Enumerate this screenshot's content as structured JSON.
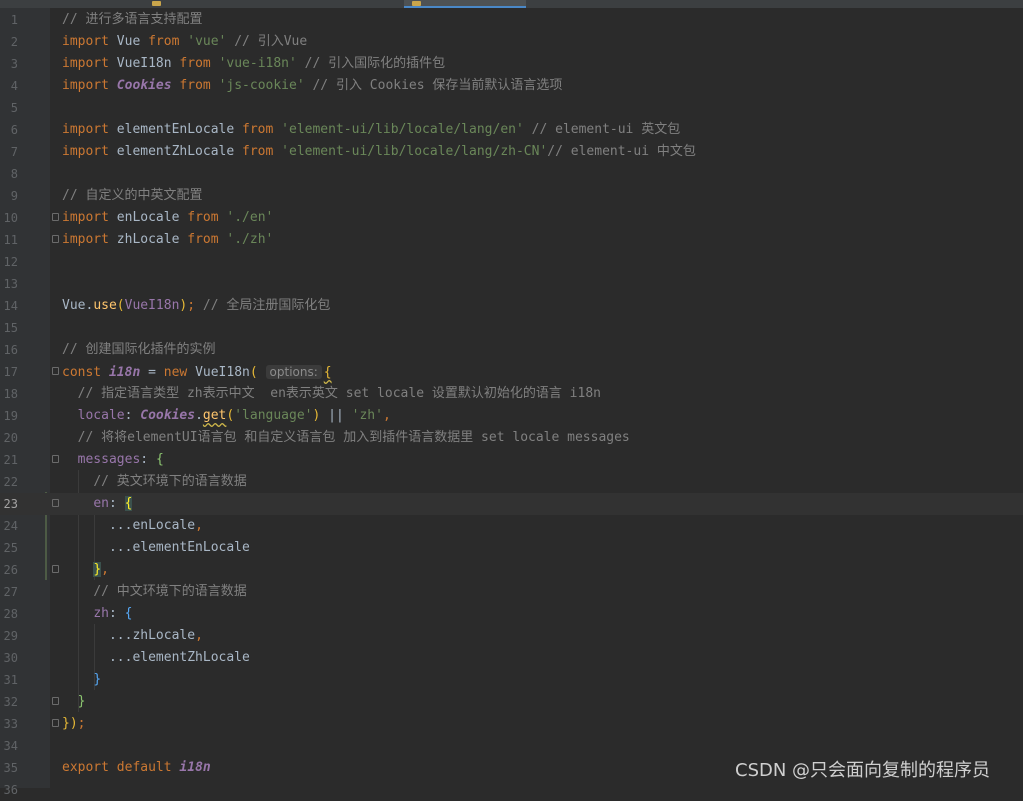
{
  "tabs": [
    {
      "label": ""
    },
    {
      "label": "",
      "active": true
    }
  ],
  "watermark": "CSDN @只会面向复制的程序员",
  "colors": {
    "background": "#2b2b2b",
    "keyword": "#cc7832",
    "string": "#6a8759",
    "comment": "#808080",
    "identifier": "#a9b7c6",
    "instance": "#9876aa",
    "function": "#ffc66d"
  },
  "editor": {
    "current_line": 23,
    "lines": [
      {
        "n": "1",
        "t": "// 进行多语言支持配置"
      },
      {
        "n": "2",
        "t": "import Vue from 'vue' // 引入Vue"
      },
      {
        "n": "3",
        "t": "import VueI18n from 'vue-i18n' // 引入国际化的插件包"
      },
      {
        "n": "4",
        "t": "import Cookies from 'js-cookie' // 引入 Cookies 保存当前默认语言选项"
      },
      {
        "n": "5",
        "t": ""
      },
      {
        "n": "6",
        "t": "import elementEnLocale from 'element-ui/lib/locale/lang/en' // element-ui 英文包"
      },
      {
        "n": "7",
        "t": "import elementZhLocale from 'element-ui/lib/locale/lang/zh-CN'// element-ui 中文包"
      },
      {
        "n": "8",
        "t": ""
      },
      {
        "n": "9",
        "t": "// 自定义的中英文配置"
      },
      {
        "n": "10",
        "t": "import enLocale from './en'"
      },
      {
        "n": "11",
        "t": "import zhLocale from './zh'"
      },
      {
        "n": "12",
        "t": ""
      },
      {
        "n": "13",
        "t": ""
      },
      {
        "n": "14",
        "t": "Vue.use(VueI18n); // 全局注册国际化包"
      },
      {
        "n": "15",
        "t": ""
      },
      {
        "n": "16",
        "t": "// 创建国际化插件的实例"
      },
      {
        "n": "17",
        "t": "const i18n = new VueI18n( options: {"
      },
      {
        "n": "18",
        "t": "  // 指定语言类型 zh表示中文  en表示英文 set locale 设置默认初始化的语言 i18n"
      },
      {
        "n": "19",
        "t": "  locale: Cookies.get('language') || 'zh',"
      },
      {
        "n": "20",
        "t": "  // 将将elementUI语言包 和自定义语言包 加入到插件语言数据里 set locale messages"
      },
      {
        "n": "21",
        "t": "  messages: {"
      },
      {
        "n": "22",
        "t": "    // 英文环境下的语言数据"
      },
      {
        "n": "23",
        "t": "    en: {"
      },
      {
        "n": "24",
        "t": "      ...enLocale,"
      },
      {
        "n": "25",
        "t": "      ...elementEnLocale"
      },
      {
        "n": "26",
        "t": "    },"
      },
      {
        "n": "27",
        "t": "    // 中文环境下的语言数据"
      },
      {
        "n": "28",
        "t": "    zh: {"
      },
      {
        "n": "29",
        "t": "      ...zhLocale,"
      },
      {
        "n": "30",
        "t": "      ...elementZhLocale"
      },
      {
        "n": "31",
        "t": "    }"
      },
      {
        "n": "32",
        "t": "  }"
      },
      {
        "n": "33",
        "t": "});"
      },
      {
        "n": "34",
        "t": ""
      },
      {
        "n": "35",
        "t": "export default i18n"
      },
      {
        "n": "36",
        "t": ""
      }
    ]
  }
}
